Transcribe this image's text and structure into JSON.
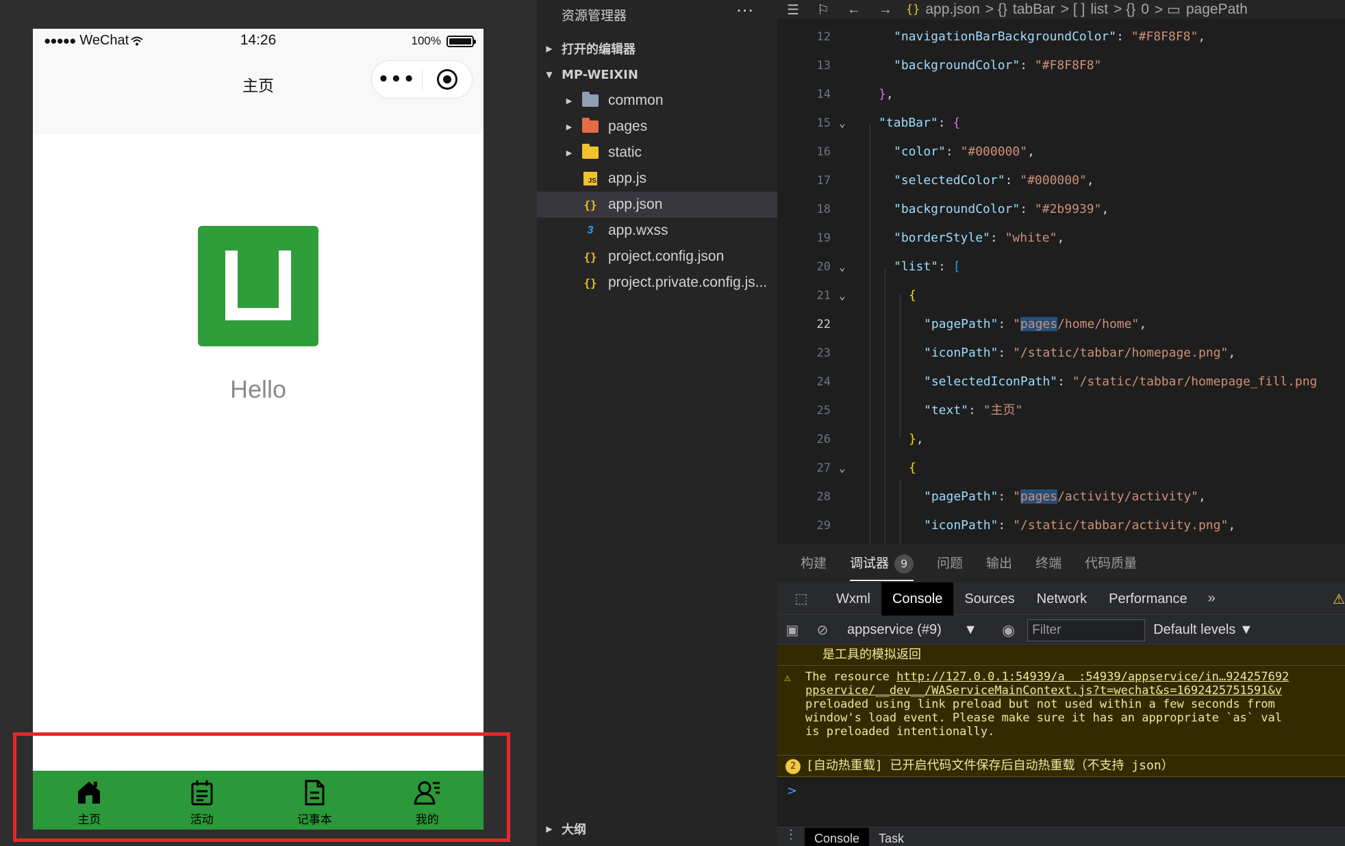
{
  "simulator": {
    "status": {
      "carrier": "WeChat",
      "signal_dots": "●●●●●",
      "time": "14:26",
      "battery": "100%"
    },
    "nav": {
      "title": "主页"
    },
    "content": {
      "greeting": "Hello"
    },
    "tabbar": {
      "background": "#2b9939",
      "items": [
        {
          "label": "主页",
          "icon": "home-icon"
        },
        {
          "label": "活动",
          "icon": "calendar-icon"
        },
        {
          "label": "记事本",
          "icon": "document-icon"
        },
        {
          "label": "我的",
          "icon": "user-icon"
        }
      ]
    },
    "highlight_color": "#e8262d"
  },
  "explorer": {
    "title": "资源管理器",
    "more": "···",
    "sections": {
      "open_editors": "打开的编辑器",
      "project": "MP-WEIXIN",
      "outline": "大纲"
    },
    "items": [
      {
        "name": "common",
        "type": "folder",
        "color": "#8fa0b3"
      },
      {
        "name": "pages",
        "type": "folder",
        "color": "#e86a47"
      },
      {
        "name": "static",
        "type": "folder",
        "color": "#f2c12e"
      },
      {
        "name": "app.js",
        "type": "js"
      },
      {
        "name": "app.json",
        "type": "json",
        "selected": true
      },
      {
        "name": "app.wxss",
        "type": "css"
      },
      {
        "name": "project.config.json",
        "type": "json"
      },
      {
        "name": "project.private.config.js...",
        "type": "json"
      }
    ]
  },
  "editor": {
    "breadcrumb": [
      "app.json",
      "tabBar",
      "list",
      "0",
      "pagePath"
    ],
    "current_line": "22"
  },
  "panel": {
    "tabs": [
      "构建",
      "调试器",
      "问题",
      "输出",
      "终端",
      "代码质量"
    ],
    "debugger_badge": "9",
    "devtools_tabs": [
      "Wxml",
      "Console",
      "Sources",
      "Network",
      "Performance"
    ],
    "devtools_more": "»",
    "context": "appservice (#9)",
    "filter_placeholder": "Filter",
    "levels": "Default levels",
    "logs": {
      "info": "是工具的模拟返回",
      "warning_prefix": "The resource ",
      "warning_link1": "http://127.0.0.1:54939/a  :54939/appservice/in…924257692",
      "warning_link2": "ppservice/__dev__/WAServiceMainContext.js?t=wechat&s=1692425751591&v",
      "warning_line3": "preloaded using link preload but not used within a few seconds from",
      "warning_line4": "window's load event. Please make sure it has an appropriate `as` val",
      "warning_line5": "is preloaded intentionally.",
      "reload_count": "2",
      "reload_text": "[自动热重载] 已开启代码文件保存后自动热重载（不支持 json）"
    },
    "prompt": ">",
    "drawer_tabs": [
      "Console",
      "Task"
    ]
  }
}
